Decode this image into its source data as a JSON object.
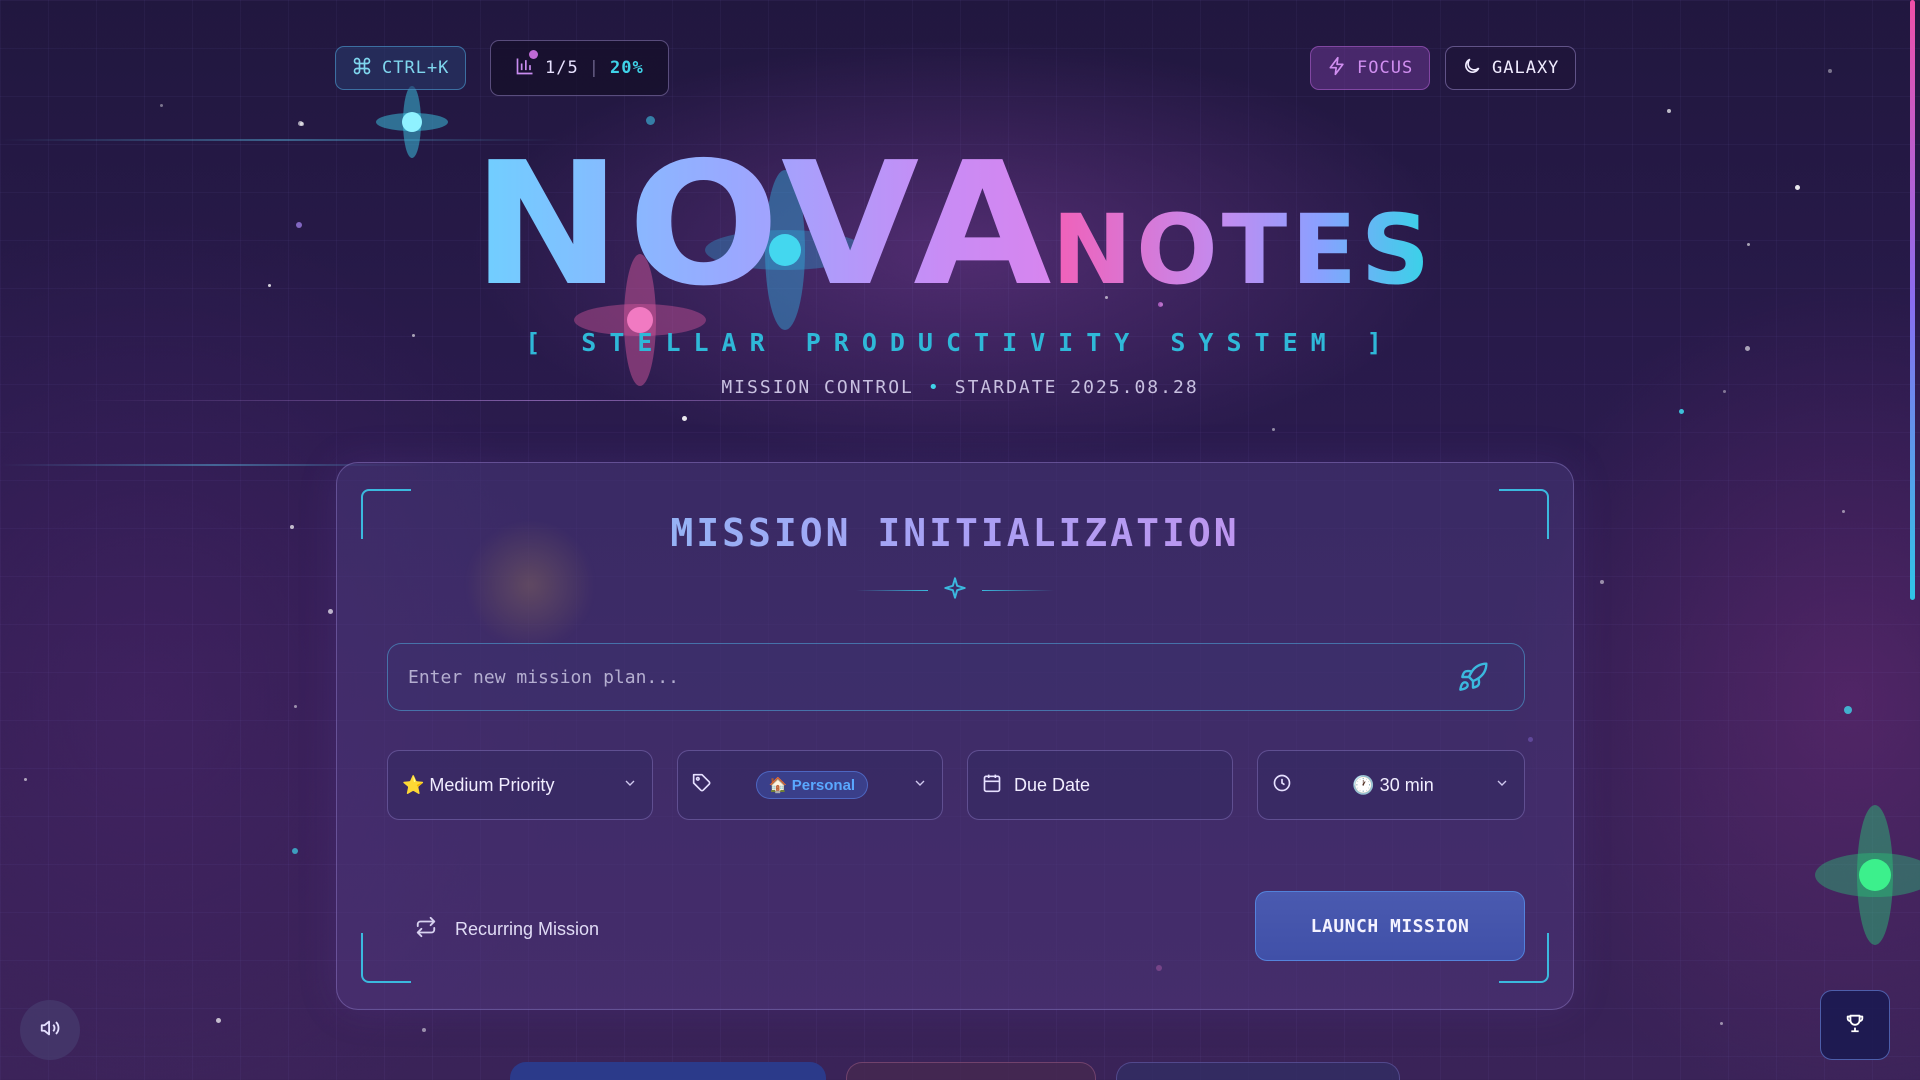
{
  "topbar": {
    "shortcut_label": "CTRL+K",
    "stats_count": "1/5",
    "stats_separator": "|",
    "stats_percent": "20%",
    "focus_label": "FOCUS",
    "theme_label": "GALAXY"
  },
  "hero": {
    "title_main": "NOVA",
    "title_sub": "NOTES",
    "tagline": "[ STELLAR PRODUCTIVITY SYSTEM ]",
    "mission_control": "MISSION CONTROL",
    "stardate": "STARDATE 2025.08.28"
  },
  "form": {
    "title": "MISSION INITIALIZATION",
    "input_placeholder": "Enter new mission plan...",
    "input_value": "",
    "priority_label": "⭐ Medium Priority",
    "category_label": "🏠 Personal",
    "due_date_label": "Due Date",
    "duration_label": "🕐 30 min",
    "recurring_label": "Recurring Mission",
    "launch_label": "LAUNCH MISSION"
  },
  "icons": {
    "shortcut": "command-icon",
    "stats": "bar-chart-icon",
    "focus": "lightning-icon",
    "theme": "moon-icon",
    "submit": "rocket-icon",
    "divider": "sparkle-icon",
    "category": "tag-icon",
    "due_date": "calendar-icon",
    "duration": "clock-icon",
    "recurring": "repeat-icon",
    "sound": "speaker-icon",
    "achievements": "trophy-icon"
  },
  "colors": {
    "accent_cyan": "#3fd3e8",
    "accent_pink": "#f160b8",
    "accent_violet": "#c88cf0",
    "launch_bg": "#4a5ab0"
  }
}
